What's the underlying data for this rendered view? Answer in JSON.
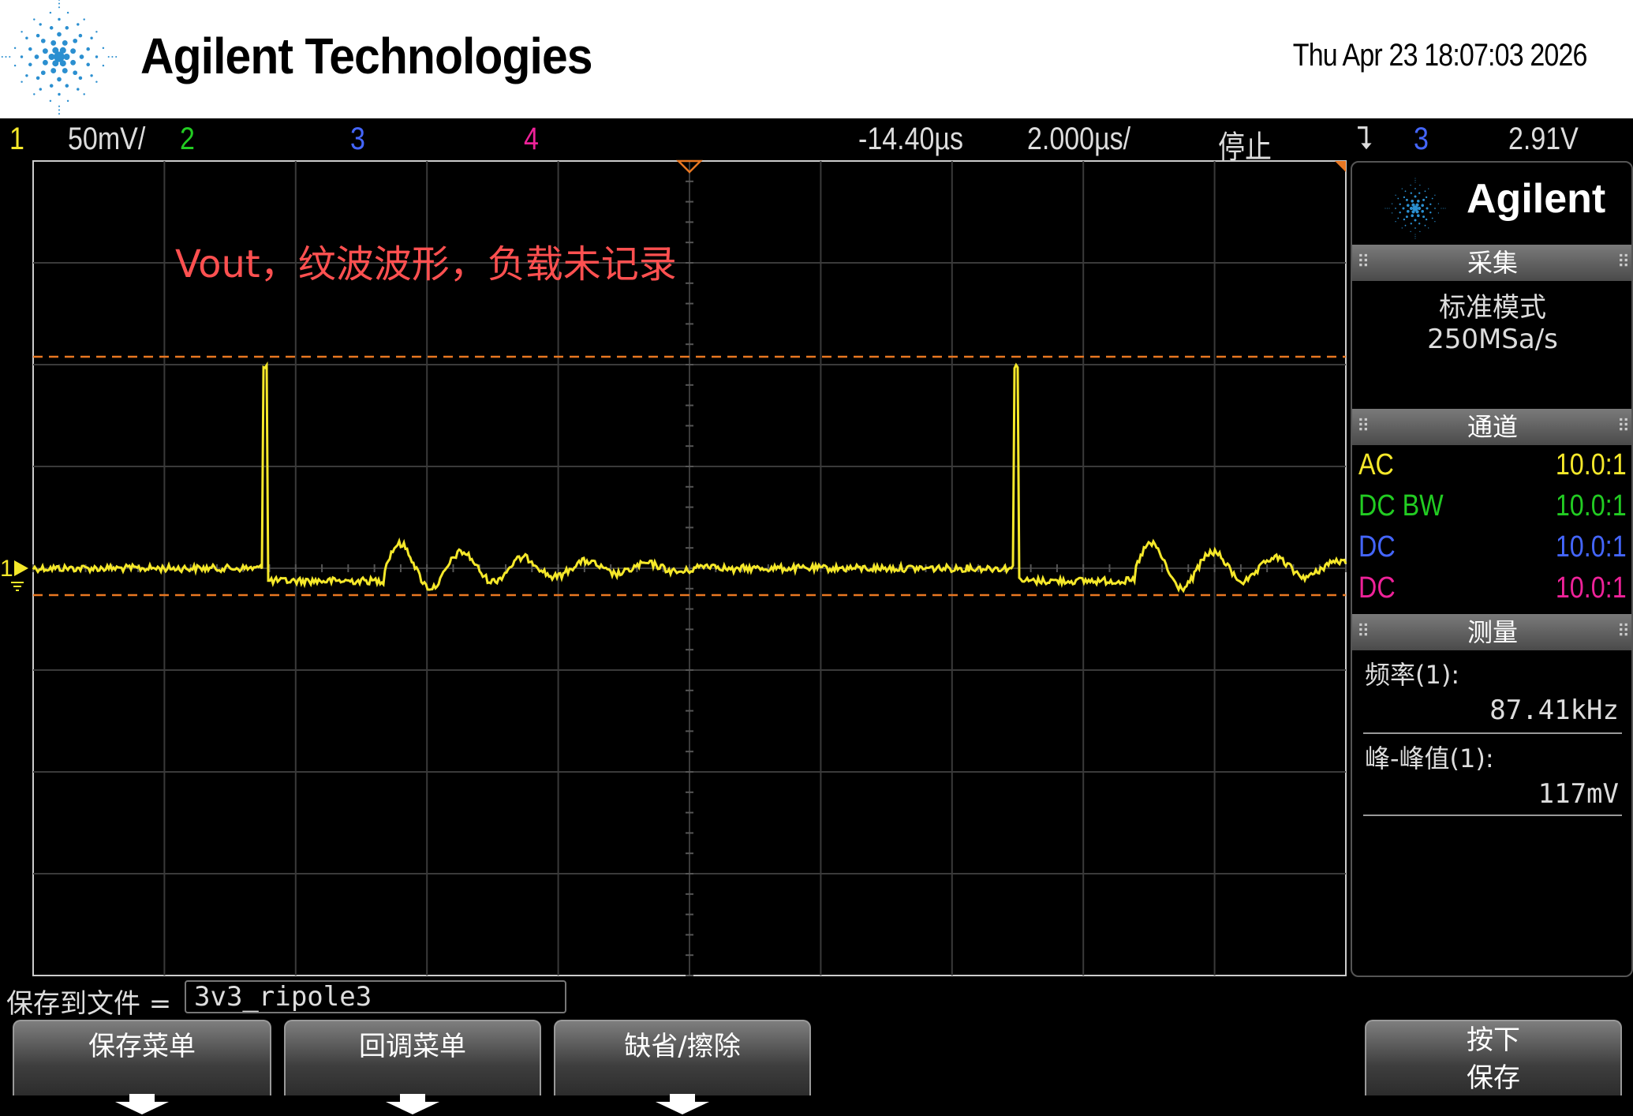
{
  "header": {
    "brand": "Agilent Technologies",
    "datetime": "Thu Apr 23 18:07:03 2026"
  },
  "status_bar": {
    "ch1_num": "1",
    "ch1_scale": "50mV/",
    "ch2_num": "2",
    "ch3_num": "3",
    "ch4_num": "4",
    "delay": "-14.40µs",
    "timebase": "2.000µs/",
    "run_state": "停止",
    "trigger_symbol": "⮧",
    "trigger_source": "3",
    "trigger_level": "2.91V"
  },
  "annotation": "Vout，纹波波形，负载未记录",
  "channel_marker": "1",
  "side_panel": {
    "brand": "Agilent",
    "acquire": {
      "title": "采集",
      "mode": "标准模式",
      "sample_rate": "250MSa/s"
    },
    "channels": {
      "title": "通道",
      "rows": [
        {
          "coupling": "AC",
          "probe": "10.0:1",
          "color": "#f5e82a"
        },
        {
          "coupling": "DC BW",
          "probe": "10.0:1",
          "color": "#22cc22"
        },
        {
          "coupling": "DC",
          "probe": "10.0:1",
          "color": "#4466ff"
        },
        {
          "coupling": "DC",
          "probe": "10.0:1",
          "color": "#ee2299"
        }
      ]
    },
    "measure": {
      "title": "测量",
      "freq_label": "频率(1):",
      "freq_value": "87.41kHz",
      "pp_label": "峰-峰值(1):",
      "pp_value": "117mV"
    }
  },
  "save": {
    "label": "保存到文件 =",
    "filename": "3v3_ripole3"
  },
  "softkeys": {
    "save_menu": "保存菜单",
    "recall_menu": "回调菜单",
    "default_erase": "缺省/擦除",
    "press_line1": "按下",
    "press_line2": "保存"
  },
  "colors": {
    "ch1": "#f5e82a",
    "ch2": "#22cc22",
    "ch3": "#4466ff",
    "ch4": "#ee2299",
    "cursor": "#e87722",
    "annotation": "#ff5050"
  },
  "waveform": {
    "channel": 1,
    "timebase_per_div": "2.000µs",
    "spike_period_divisions": 5.7,
    "ripple": true
  }
}
